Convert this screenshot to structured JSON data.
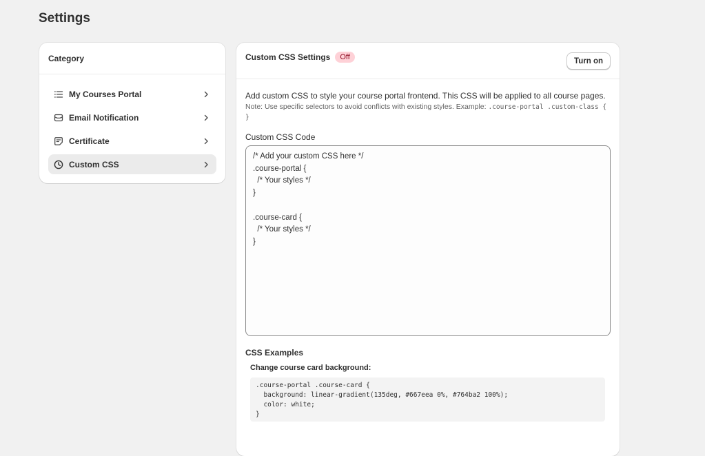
{
  "page": {
    "title": "Settings"
  },
  "sidebar": {
    "header": "Category",
    "items": [
      {
        "label": "My Courses Portal",
        "icon": "list-icon",
        "active": false
      },
      {
        "label": "Email Notification",
        "icon": "mail-icon",
        "active": false
      },
      {
        "label": "Certificate",
        "icon": "note-icon",
        "active": false
      },
      {
        "label": "Custom CSS",
        "icon": "clock-icon",
        "active": true
      }
    ]
  },
  "main": {
    "title": "Custom CSS Settings",
    "status_badge": "Off",
    "toggle_button": "Turn on",
    "description": "Add custom CSS to style your course portal frontend. This CSS will be applied to all course pages.",
    "note_prefix": "Note: Use specific selectors to avoid conflicts with existing styles. Example: ",
    "note_example": ".course-portal .custom-class { }",
    "field_label": "Custom CSS Code",
    "css_code": "/* Add your custom CSS here */\n.course-portal {\n  /* Your styles */\n}\n\n.course-card {\n  /* Your styles */\n}",
    "examples_title": "CSS Examples",
    "examples": [
      {
        "title": "Change course card background:",
        "code": ".course-portal .course-card {\n  background: linear-gradient(135deg, #667eea 0%, #764ba2 100%);\n  color: white;\n}"
      }
    ]
  },
  "colors": {
    "page_background": "#f1f1f1",
    "card_background": "#ffffff",
    "active_item": "#ebebeb",
    "badge_off_bg": "#fed1d7",
    "badge_off_text": "#8e0b21"
  }
}
